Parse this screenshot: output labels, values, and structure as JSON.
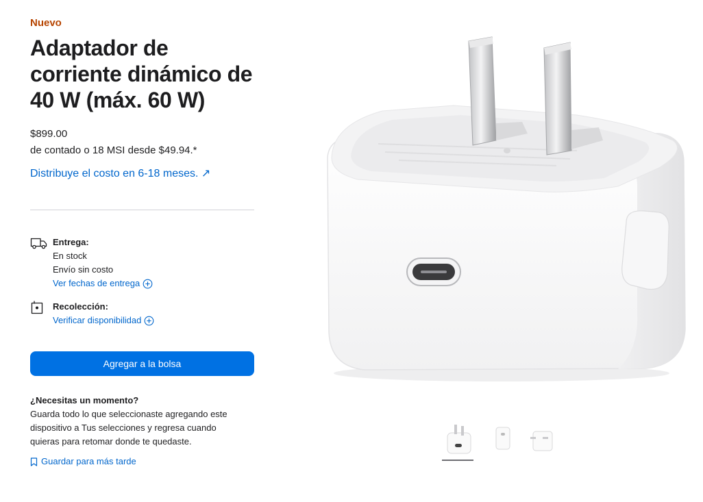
{
  "product": {
    "badge": "Nuevo",
    "title": "Adaptador de corriente dinámico de 40 W (máx. 60 W)",
    "price": "$899.00",
    "financing": "de contado o 18 MSI desde $49.94.*",
    "spread_link": "Distribuye el costo en 6-18 meses. ↗"
  },
  "delivery": {
    "icon": "truck-icon",
    "heading": "Entrega:",
    "status": "En stock",
    "shipping": "Envío sin costo",
    "link": "Ver fechas de entrega"
  },
  "pickup": {
    "icon": "store-bag-icon",
    "heading": "Recolección:",
    "link": "Verificar disponibilidad"
  },
  "cart": {
    "button_label": "Agregar a la bolsa"
  },
  "save": {
    "title": "¿Necesitas un momento?",
    "description": "Guarda todo lo que seleccionaste agregando este dispositivo a Tus selecciones y regresa cuando quieras para retomar donde te quedaste.",
    "link": "Guardar para más tarde"
  },
  "gallery": {
    "thumbnails": [
      "front-view",
      "side-view",
      "folded-prongs-view"
    ],
    "selected_index": 0
  },
  "colors": {
    "badge": "#b64400",
    "link": "#0066cc",
    "button": "#0071e3"
  }
}
